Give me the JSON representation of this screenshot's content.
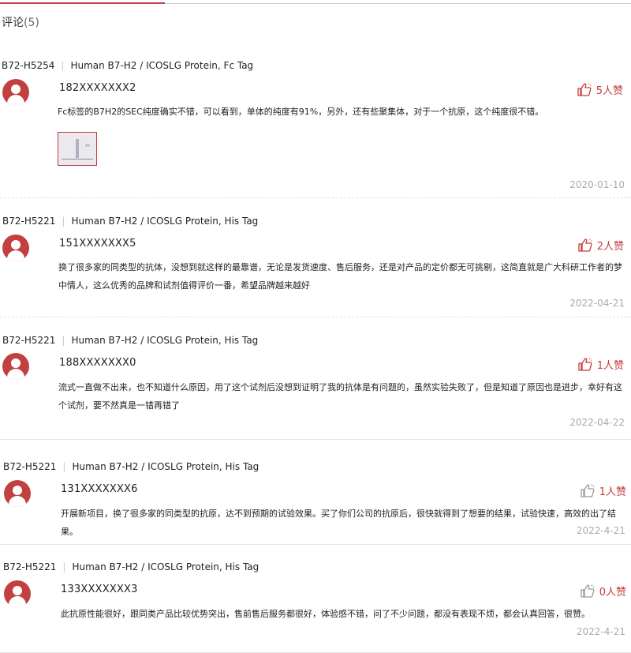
{
  "heading": {
    "label": "评论",
    "count": "(5)"
  },
  "reviews": [
    {
      "code": "B72-H5254",
      "product": "Human B7-H2 / ICOSLG Protein, Fc Tag",
      "user": "182XXXXXXX2",
      "likes": "5人赞",
      "text": "Fc标签的B7H2的SEC纯度确实不错，可以看到，单体的纯度有91%，另外，还有些聚集体，对于一个抗原，这个纯度很不错。",
      "date": "2020-01-10"
    },
    {
      "code": "B72-H5221",
      "product": "Human B7-H2 / ICOSLG Protein, His Tag",
      "user": "151XXXXXXX5",
      "likes": "2人赞",
      "text": "换了很多家的同类型的抗体，没想到就这样的最靠谱，无论是发货速度、售后服务，还是对产品的定价都无可挑剔，这简直就是广大科研工作者的梦中情人，这么优秀的品牌和试剂值得评价一番，希望品牌越来越好",
      "date": "2022-04-21"
    },
    {
      "code": "B72-H5221",
      "product": "Human B7-H2 / ICOSLG Protein, His Tag",
      "user": "188XXXXXXX0",
      "likes": "1人赞",
      "text": "流式一直做不出来，也不知道什么原因，用了这个试剂后没想到证明了我的抗体是有问题的，虽然实验失败了，但是知道了原因也是进步，幸好有这个试剂，要不然真是一错再错了",
      "date": "2022-04-22"
    },
    {
      "code": "B72-H5221",
      "product": "Human B7-H2 / ICOSLG Protein, His Tag",
      "user": "131XXXXXXX6",
      "likes": "1人赞",
      "text": "开展新项目，换了很多家的同类型的抗原，达不到预期的试验效果。买了你们公司的抗原后，很快就得到了想要的结果，试验快速，高效的出了结果。",
      "date": "2022-4-21"
    },
    {
      "code": "B72-H5221",
      "product": "Human B7-H2 / ICOSLG Protein, His Tag",
      "user": "133XXXXXXX3",
      "likes": "0人赞",
      "text": "此抗原性能很好，跟同类产品比较优势突出，售前售后服务都很好，体验感不错，问了不少问题，都没有表现不烦，都会认真回答，很赞。",
      "date": "2022-4-21"
    }
  ],
  "colors": {
    "accent": "#c43c3c",
    "like_active": "#c43c3c",
    "like_inactive": "#999999"
  },
  "icons": {
    "like": "thumbs-up-icon",
    "avatar": "user-avatar-icon"
  }
}
